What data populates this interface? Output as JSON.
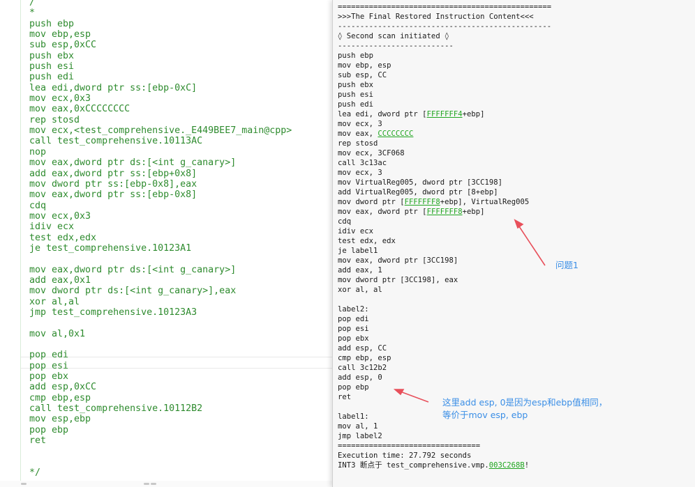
{
  "editor": {
    "lines": [
      "/",
      "*",
      "push ebp",
      "mov ebp,esp",
      "sub esp,0xCC",
      "push ebx",
      "push esi",
      "push edi",
      "lea edi,dword ptr ss:[ebp-0xC]",
      "mov ecx,0x3",
      "mov eax,0xCCCCCCCC",
      "rep stosd",
      "mov ecx,<test_comprehensive._E449BEE7_main@cpp>",
      "call test_comprehensive.10113AC",
      "nop",
      "mov eax,dword ptr ds:[<int g_canary>]",
      "add eax,dword ptr ss:[ebp+0x8]",
      "mov dword ptr ss:[ebp-0x8],eax",
      "mov eax,dword ptr ss:[ebp-0x8]",
      "cdq",
      "mov ecx,0x3",
      "idiv ecx",
      "test edx,edx",
      "je test_comprehensive.10123A1",
      "",
      "mov eax,dword ptr ds:[<int g_canary>]",
      "add eax,0x1",
      "mov dword ptr ds:[<int g_canary>],eax",
      "xor al,al",
      "jmp test_comprehensive.10123A3",
      "",
      "mov al,0x1",
      "",
      "pop edi",
      "pop esi",
      "pop ebx",
      "add esp,0xCC",
      "cmp ebp,esp",
      "call test_comprehensive.10112B2",
      "mov esp,ebp",
      "pop ebp",
      "ret",
      "",
      "",
      "*/"
    ]
  },
  "console": {
    "lines": [
      [
        {
          "t": "                                              "
        }
      ],
      [
        {
          "t": "================================================"
        }
      ],
      [
        {
          "t": ">>>The Final Restored Instruction Content<<<"
        }
      ],
      [
        {
          "t": "------------------------------------------------"
        }
      ],
      [
        {
          "t": "◊ Second scan initiated ◊"
        }
      ],
      [
        {
          "t": "--------------------------"
        }
      ],
      [
        {
          "t": "push ebp"
        }
      ],
      [
        {
          "t": "mov ebp, esp"
        }
      ],
      [
        {
          "t": "sub esp, CC"
        }
      ],
      [
        {
          "t": "push ebx"
        }
      ],
      [
        {
          "t": "push esi"
        }
      ],
      [
        {
          "t": "push edi"
        }
      ],
      [
        {
          "t": "lea edi, dword ptr ["
        },
        {
          "t": "FFFFFFF4",
          "link": true
        },
        {
          "t": "+ebp]"
        }
      ],
      [
        {
          "t": "mov ecx, 3"
        }
      ],
      [
        {
          "t": "mov eax, "
        },
        {
          "t": "CCCCCCCC",
          "link": true
        }
      ],
      [
        {
          "t": "rep stosd"
        }
      ],
      [
        {
          "t": "mov ecx, 3CF068"
        }
      ],
      [
        {
          "t": "call 3c13ac"
        }
      ],
      [
        {
          "t": "mov ecx, 3"
        }
      ],
      [
        {
          "t": "mov VirtualReg005, dword ptr [3CC198]"
        }
      ],
      [
        {
          "t": "add VirtualReg005, dword ptr [8+ebp]"
        }
      ],
      [
        {
          "t": "mov dword ptr ["
        },
        {
          "t": "FFFFFFF8",
          "link": true
        },
        {
          "t": "+ebp], VirtualReg005"
        }
      ],
      [
        {
          "t": "mov eax, dword ptr ["
        },
        {
          "t": "FFFFFFF8",
          "link": true
        },
        {
          "t": "+ebp]"
        }
      ],
      [
        {
          "t": "cdq"
        }
      ],
      [
        {
          "t": "idiv ecx"
        }
      ],
      [
        {
          "t": "test edx, edx"
        }
      ],
      [
        {
          "t": "je label1"
        }
      ],
      [
        {
          "t": "mov eax, dword ptr [3CC198]"
        }
      ],
      [
        {
          "t": "add eax, 1"
        }
      ],
      [
        {
          "t": "mov dword ptr [3CC198], eax"
        }
      ],
      [
        {
          "t": "xor al, al"
        }
      ],
      [
        {
          "t": ""
        }
      ],
      [
        {
          "t": "label2:"
        }
      ],
      [
        {
          "t": "pop edi"
        }
      ],
      [
        {
          "t": "pop esi"
        }
      ],
      [
        {
          "t": "pop ebx"
        }
      ],
      [
        {
          "t": "add esp, CC"
        }
      ],
      [
        {
          "t": "cmp ebp, esp"
        }
      ],
      [
        {
          "t": "call 3c12b2"
        }
      ],
      [
        {
          "t": "add esp, 0"
        }
      ],
      [
        {
          "t": "pop ebp"
        }
      ],
      [
        {
          "t": "ret"
        }
      ],
      [
        {
          "t": ""
        }
      ],
      [
        {
          "t": "label1:"
        }
      ],
      [
        {
          "t": "mov al, 1"
        }
      ],
      [
        {
          "t": "jmp label2"
        }
      ],
      [
        {
          "t": "================================"
        }
      ],
      [
        {
          "t": "Execution time: 27.792 seconds"
        }
      ],
      [
        {
          "t": "INT3 断点于 test_comprehensive.vmp."
        },
        {
          "t": "003C268B",
          "link": true
        },
        {
          "t": "!"
        }
      ]
    ]
  },
  "annotations": {
    "note1": "问题1",
    "note2_line1": "这里add esp, 0是因为esp和ebp值相同，",
    "note2_line2": "等价于mov esp, ebp"
  },
  "colors": {
    "editor_text": "#2e8b2e",
    "console_link": "#1fa51f",
    "annotation": "#3a8ee6",
    "arrow": "#e8505b"
  }
}
